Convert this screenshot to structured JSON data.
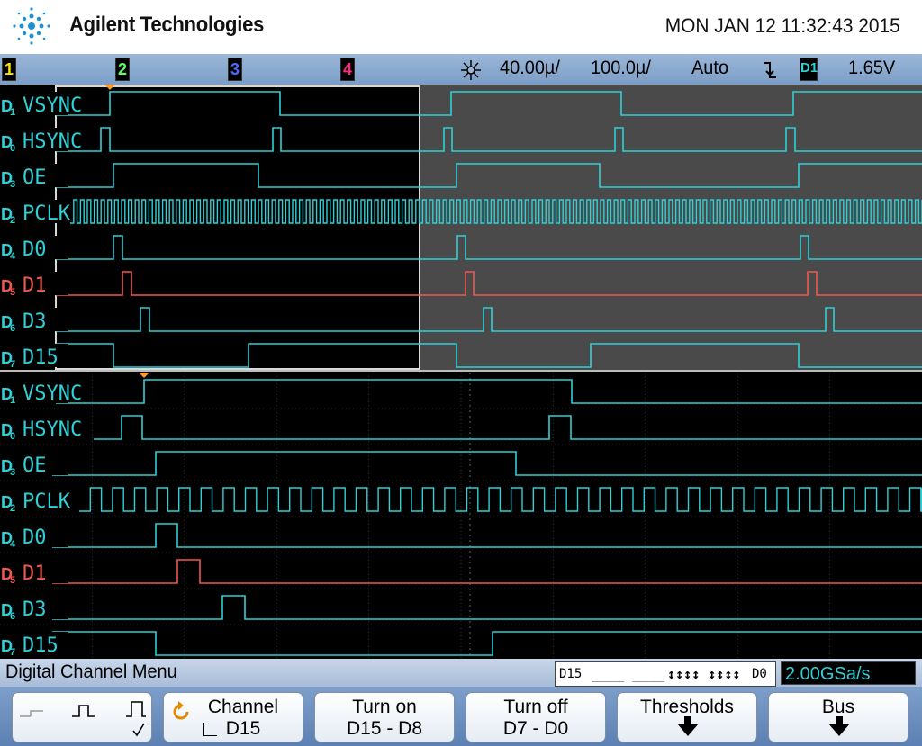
{
  "brand": {
    "name": "Agilent Technologies",
    "logo_icon": "agilent-spark-icon"
  },
  "datetime": "MON JAN 12 11:32:43 2015",
  "status": {
    "channels": [
      "1",
      "2",
      "3",
      "4"
    ],
    "channel_colors": [
      "#f7e600",
      "#5cff5c",
      "#4a6bff",
      "#ff2b7a"
    ],
    "acq_icon": "run-star-icon",
    "time_div": "40.00µ/",
    "delay": "100.0µ/",
    "trigger_mode": "Auto",
    "trigger_edge_icon": "falling-edge-icon",
    "trigger_source": "D1",
    "trigger_level": "1.65V"
  },
  "zoom_labels": [
    {
      "ch": "D1",
      "name": "VSYNC",
      "color": "#2fd0d6"
    },
    {
      "ch": "D0",
      "name": "HSYNC",
      "color": "#2fd0d6"
    },
    {
      "ch": "D3",
      "name": "OE",
      "color": "#2fd0d6"
    },
    {
      "ch": "D2",
      "name": "PCLK",
      "color": "#2fd0d6"
    },
    {
      "ch": "D4",
      "name": "D0",
      "color": "#2fd0d6"
    },
    {
      "ch": "D5",
      "name": "D1",
      "color": "#f0574f"
    },
    {
      "ch": "D6",
      "name": "D3",
      "color": "#2fd0d6"
    },
    {
      "ch": "D7",
      "name": "D15",
      "color": "#2fd0d6"
    }
  ],
  "main_labels": [
    {
      "ch": "D1",
      "name": "VSYNC",
      "color": "#2fd0d6"
    },
    {
      "ch": "D0",
      "name": "HSYNC",
      "color": "#2fd0d6"
    },
    {
      "ch": "D3",
      "name": "OE",
      "color": "#2fd0d6"
    },
    {
      "ch": "D2",
      "name": "PCLK",
      "color": "#2fd0d6"
    },
    {
      "ch": "D4",
      "name": "D0",
      "color": "#2fd0d6"
    },
    {
      "ch": "D5",
      "name": "D1",
      "color": "#f0574f"
    },
    {
      "ch": "D6",
      "name": "D3",
      "color": "#2fd0d6"
    },
    {
      "ch": "D7",
      "name": "D15",
      "color": "#2fd0d6"
    }
  ],
  "menu": {
    "title": "Digital Channel Menu",
    "bit_display": {
      "high": "D15",
      "low": "D0",
      "dashes": "____ ____",
      "arrows": "↕↕↕↕ ↕↕↕↕"
    },
    "sample_rate": "2.00GSa/s"
  },
  "softkeys": [
    {
      "id": "threshold-style",
      "line1": "",
      "line2": ""
    },
    {
      "id": "channel",
      "line1": "Channel",
      "line2": "D15"
    },
    {
      "id": "turn-on",
      "line1": "Turn on",
      "line2": "D15 - D8"
    },
    {
      "id": "turn-off",
      "line1": "Turn off",
      "line2": "D7 - D0"
    },
    {
      "id": "thresholds",
      "line1": "Thresholds",
      "line2": ""
    },
    {
      "id": "bus",
      "line1": "Bus",
      "line2": ""
    }
  ]
}
